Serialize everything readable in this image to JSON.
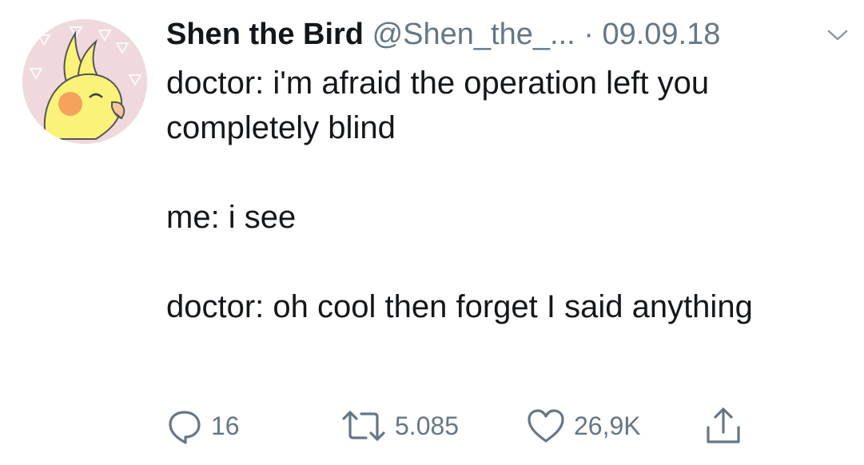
{
  "tweet": {
    "display_name": "Shen the Bird",
    "handle": "@Shen_the_...",
    "separator": "·",
    "date": "09.09.18",
    "paragraphs": [
      "doctor: i'm afraid the operation left you completely blind",
      "me: i see",
      "doctor: oh cool then forget I said anything"
    ]
  },
  "actions": {
    "reply_count": "16",
    "retweet_count": "5.085",
    "like_count": "26,9K"
  },
  "icons": {
    "reply": "speech-bubble-icon",
    "retweet": "retweet-arrows-icon",
    "like": "heart-icon",
    "share": "share-upload-icon",
    "menu": "chevron-down-icon"
  },
  "colors": {
    "text": "#14171a",
    "secondary": "#657786",
    "avatar_bg": "#efd9dc",
    "bird_yellow": "#fbf27a",
    "cheek": "#f7a25a"
  }
}
